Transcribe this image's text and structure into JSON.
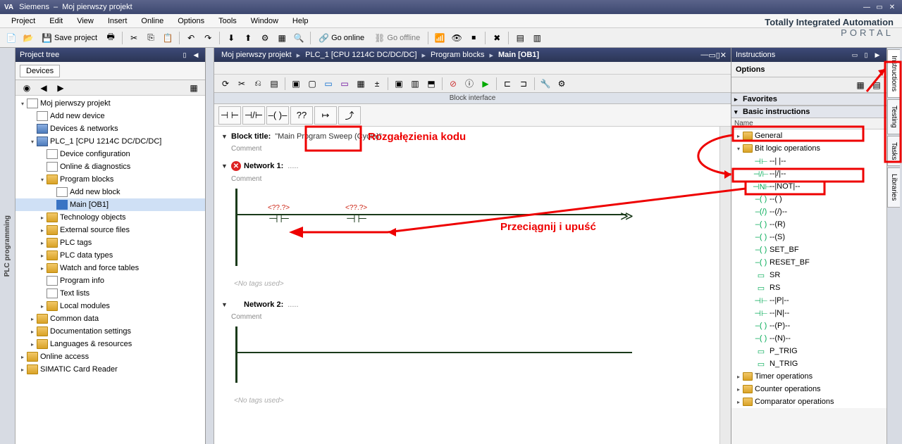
{
  "titlebar": {
    "vendor": "Siemens",
    "sep": "–",
    "project": "Moj pierwszy projekt"
  },
  "menu": [
    "Project",
    "Edit",
    "View",
    "Insert",
    "Online",
    "Options",
    "Tools",
    "Window",
    "Help"
  ],
  "brand": {
    "line1": "Totally Integrated Automation",
    "line2": "PORTAL"
  },
  "toolbar": {
    "save_label": "Save project",
    "go_online": "Go online",
    "go_offline": "Go offline"
  },
  "pt": {
    "title": "Project tree",
    "tab": "Devices",
    "items": [
      {
        "d": 0,
        "tw": "▾",
        "ic": "ic-doc",
        "t": "Moj pierwszy projekt"
      },
      {
        "d": 1,
        "tw": "",
        "ic": "ic-doc",
        "t": "Add new device"
      },
      {
        "d": 1,
        "tw": "",
        "ic": "ic-cpu",
        "t": "Devices & networks"
      },
      {
        "d": 1,
        "tw": "▾",
        "ic": "ic-cpu",
        "t": "PLC_1 [CPU 1214C DC/DC/DC]"
      },
      {
        "d": 2,
        "tw": "",
        "ic": "ic-doc",
        "t": "Device configuration"
      },
      {
        "d": 2,
        "tw": "",
        "ic": "ic-doc",
        "t": "Online & diagnostics"
      },
      {
        "d": 2,
        "tw": "▾",
        "ic": "ic-folder",
        "t": "Program blocks"
      },
      {
        "d": 3,
        "tw": "",
        "ic": "ic-doc",
        "t": "Add new block"
      },
      {
        "d": 3,
        "tw": "",
        "ic": "ic-blue",
        "t": "Main [OB1]",
        "sel": true
      },
      {
        "d": 2,
        "tw": "▸",
        "ic": "ic-folder",
        "t": "Technology objects"
      },
      {
        "d": 2,
        "tw": "▸",
        "ic": "ic-folder",
        "t": "External source files"
      },
      {
        "d": 2,
        "tw": "▸",
        "ic": "ic-folder",
        "t": "PLC tags"
      },
      {
        "d": 2,
        "tw": "▸",
        "ic": "ic-folder",
        "t": "PLC data types"
      },
      {
        "d": 2,
        "tw": "▸",
        "ic": "ic-folder",
        "t": "Watch and force tables"
      },
      {
        "d": 2,
        "tw": "",
        "ic": "ic-doc",
        "t": "Program info"
      },
      {
        "d": 2,
        "tw": "",
        "ic": "ic-doc",
        "t": "Text lists"
      },
      {
        "d": 2,
        "tw": "▸",
        "ic": "ic-folder",
        "t": "Local modules"
      },
      {
        "d": 1,
        "tw": "▸",
        "ic": "ic-folder",
        "t": "Common data"
      },
      {
        "d": 1,
        "tw": "▸",
        "ic": "ic-folder",
        "t": "Documentation settings"
      },
      {
        "d": 1,
        "tw": "▸",
        "ic": "ic-folder",
        "t": "Languages & resources"
      },
      {
        "d": 0,
        "tw": "▸",
        "ic": "ic-folder",
        "t": "Online access"
      },
      {
        "d": 0,
        "tw": "▸",
        "ic": "ic-folder",
        "t": "SIMATIC Card Reader"
      }
    ]
  },
  "leftstrip": "PLC programming",
  "editor": {
    "crumb": [
      "Moj pierwszy projekt",
      "PLC_1 [CPU 1214C DC/DC/DC]",
      "Program blocks",
      "Main [OB1]"
    ],
    "block_interface": "Block interface",
    "block_title_label": "Block title:",
    "block_title_val": "\"Main Program Sweep (Cycle)\"",
    "comment": "Comment",
    "net1": "Network 1:",
    "net1_dots": ".....",
    "net2": "Network 2:",
    "net2_dots": ".....",
    "no_tags": "<No tags used>",
    "unk_tag": "<??.?>",
    "lad_btns": [
      "⊣ ⊢",
      "⊣/⊢",
      "–( )–",
      "??",
      "↦",
      "⤴"
    ]
  },
  "right": {
    "title": "Instructions",
    "options": "Options",
    "fav": "Favorites",
    "basic": "Basic instructions",
    "name_col": "Name",
    "groups": {
      "general": "General",
      "bitlogic": "Bit logic operations",
      "timer": "Timer operations",
      "counter": "Counter operations",
      "comp": "Comparator operations"
    },
    "bit_ops": [
      {
        "s": "⊣⊢",
        "t": "--| |--"
      },
      {
        "s": "⊣/⊢",
        "t": "--|/|--"
      },
      {
        "s": "⊣N⊢",
        "t": "--|NOT|--"
      },
      {
        "s": "–( )",
        "t": "--( )"
      },
      {
        "s": "–(/)",
        "t": "--(/)--"
      },
      {
        "s": "–( )",
        "t": "--(R)"
      },
      {
        "s": "–( )",
        "t": "--(S)"
      },
      {
        "s": "–( )",
        "t": "SET_BF"
      },
      {
        "s": "–( )",
        "t": "RESET_BF"
      },
      {
        "s": "▭",
        "t": "SR"
      },
      {
        "s": "▭",
        "t": "RS"
      },
      {
        "s": "⊣⊢",
        "t": "--|P|--"
      },
      {
        "s": "⊣⊢",
        "t": "--|N|--"
      },
      {
        "s": "–( )",
        "t": "--(P)--"
      },
      {
        "s": "–( )",
        "t": "--(N)--"
      },
      {
        "s": "▭",
        "t": "P_TRIG"
      },
      {
        "s": "▭",
        "t": "N_TRIG"
      }
    ]
  },
  "rtabs": [
    "Instructions",
    "Testing",
    "Tasks",
    "Libraries"
  ],
  "annotations": {
    "branch": "Rozgałęzienia kodu",
    "dragdrop": "Przeciągnij i upuść"
  }
}
